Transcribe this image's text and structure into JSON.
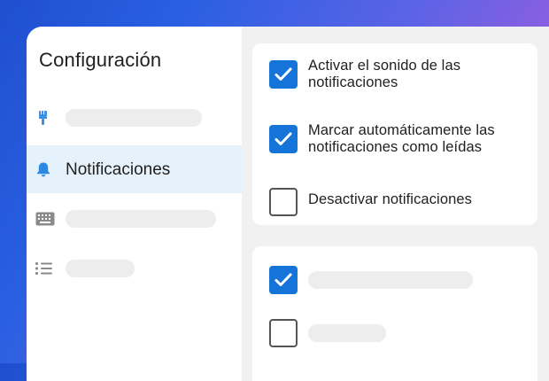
{
  "sidebar": {
    "title": "Configuración",
    "items": [
      {
        "icon": "paintbrush-icon",
        "label": ""
      },
      {
        "icon": "bell-icon",
        "label": "Notificaciones"
      },
      {
        "icon": "keyboard-icon",
        "label": ""
      },
      {
        "icon": "list-icon",
        "label": ""
      }
    ]
  },
  "notifications": {
    "options": [
      {
        "label": "Activar el sonido de las notificaciones",
        "checked": true
      },
      {
        "label": "Marcar automáticamente las notificaciones como leídas",
        "checked": true
      },
      {
        "label": "Desactivar notificaciones",
        "checked": false
      }
    ]
  },
  "second_card": {
    "options": [
      {
        "label": "",
        "checked": true
      },
      {
        "label": "",
        "checked": false
      }
    ]
  },
  "colors": {
    "accent": "#1474d8",
    "active_item_bg": "#e6f2fb",
    "icon": "#3d8fe0"
  }
}
